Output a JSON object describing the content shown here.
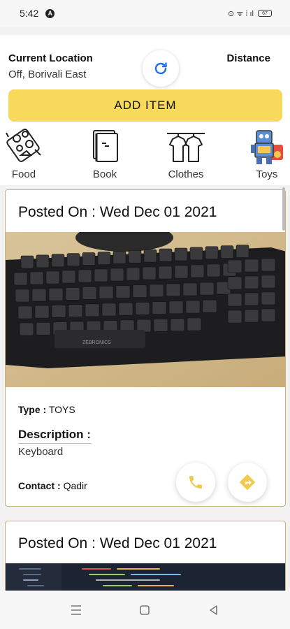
{
  "status_bar": {
    "time": "5:42",
    "notification_glyph": "A",
    "right_glyphs": "⊙ ᯤ ⁞ ıl",
    "battery": "67"
  },
  "header": {
    "location_label": "Current Location",
    "location_value": "Off, Borivali East",
    "distance_label": "Distance",
    "add_item_label": "ADD ITEM"
  },
  "categories": [
    {
      "label": "Food",
      "icon": "food-icon"
    },
    {
      "label": "Book",
      "icon": "book-icon"
    },
    {
      "label": "Clothes",
      "icon": "clothes-icon"
    },
    {
      "label": "Toys",
      "icon": "toys-icon"
    }
  ],
  "posts": [
    {
      "posted_on": "Posted On : Wed Dec 01 2021",
      "image_brand": "ZEBRONICS",
      "type_label": "Type :",
      "type_value": "TOYS",
      "description_label": "Description :",
      "description_value": "Keyboard",
      "contact_label": "Contact :",
      "contact_value": "Qadir"
    },
    {
      "posted_on": "Posted On : Wed Dec 01 2021"
    }
  ],
  "colors": {
    "accent": "#f7d95c",
    "refresh_blue": "#1e6fe8",
    "call_icon": "#f2c94c"
  }
}
